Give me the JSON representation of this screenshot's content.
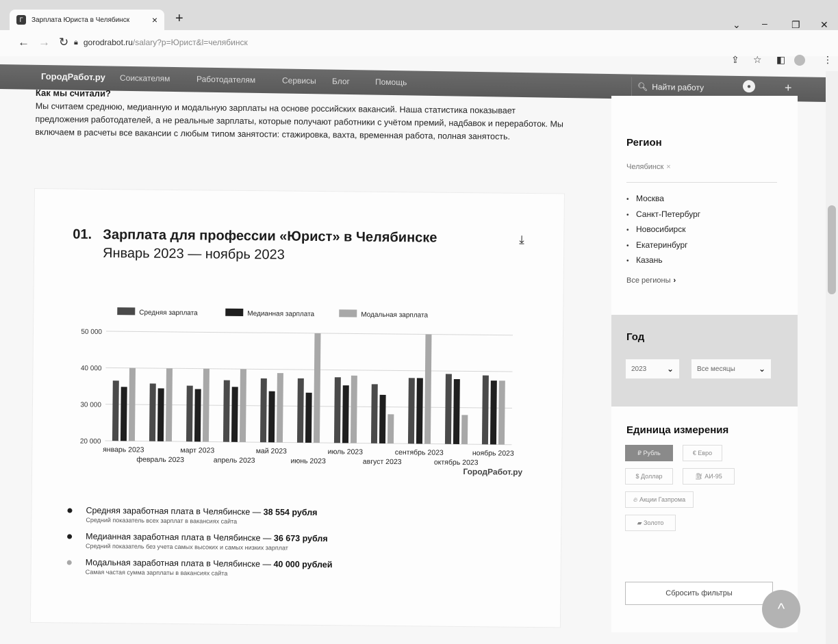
{
  "browser": {
    "tab_title": "Зарплата Юриста в Челябинск",
    "tab_close": "×",
    "new_tab": "+",
    "url": "gorodrabot.ru/salary?p=Юрист&l=челябинск",
    "url_host": "gorodrabot.ru",
    "url_rest": "/salary?p=Юрист&l=челябинск"
  },
  "site": {
    "logo": "ГородРабот.ру",
    "nav": [
      "Соискателям",
      "Работодателям",
      "Сервисы",
      "Блог",
      "Помощь"
    ],
    "find_job": "Найти работу",
    "plus": "+"
  },
  "intro": {
    "heading": "Как мы считали?",
    "text": "Мы считаем среднюю, медианную и модальную зарплаты на основе российских вакансий. Наша статистика показывает предложения работодателей, а не реальные зарплаты, которые получают работники с учётом премий, надбавок и переработок. Мы включаем в расчеты все вакансии с любым типом занятости: стажировка, вахта, временная работа, полная занятость."
  },
  "chart_section": {
    "number": "01.",
    "title": "Зарплата для профессии «Юрист» в Челябинске",
    "subtitle": "Январь 2023 — ноябрь 2023",
    "watermark": "ГородРабот.ру"
  },
  "chart_data": {
    "type": "bar",
    "categories": [
      "январь 2023",
      "февраль 2023",
      "март 2023",
      "апрель 2023",
      "май 2023",
      "июнь 2023",
      "июль 2023",
      "август 2023",
      "сентябрь 2023",
      "октябрь 2023",
      "ноябрь 2023"
    ],
    "series": [
      {
        "name": "Средняя зарплата",
        "color": "#4a4a4a",
        "values": [
          36500,
          35800,
          35300,
          36900,
          37500,
          37600,
          38000,
          36200,
          38000,
          39200,
          38900
        ]
      },
      {
        "name": "Медианная зарплата",
        "color": "#1f1f1f",
        "values": [
          34800,
          34500,
          34400,
          35100,
          34000,
          33700,
          35800,
          33300,
          38000,
          37800,
          37500
        ]
      },
      {
        "name": "Модальная зарплата",
        "color": "#a8a8a8",
        "values": [
          40000,
          40000,
          40000,
          40000,
          39000,
          50000,
          38500,
          28000,
          50000,
          28000,
          37500
        ]
      }
    ],
    "yticks": [
      "20 000",
      "30 000",
      "40 000",
      "50 000"
    ],
    "ylim": [
      20000,
      50000
    ],
    "grid": true,
    "legend": "top"
  },
  "stats": [
    {
      "color": "#1f1f1f",
      "title": "Средняя заработная плата в Челябинске — ",
      "value": "38 554 рубля",
      "desc": "Средний показатель всех зарплат в вакансиях сайта"
    },
    {
      "color": "#1f1f1f",
      "title": "Медианная заработная плата в Челябинске — ",
      "value": "36 673 рубля",
      "desc": "Средний показатель без учета самых высоких и самых низких зарплат"
    },
    {
      "color": "#a8a8a8",
      "title": "Модальная заработная плата в Челябинске — ",
      "value": "40 000 рублей",
      "desc": "Самая частая сумма зарплаты в вакансиях сайта"
    }
  ],
  "sidebar": {
    "region": {
      "heading": "Регион",
      "selected": "Челябинск",
      "selected_remove": "×",
      "list": [
        "Москва",
        "Санкт-Петербург",
        "Новосибирск",
        "Екатеринбург",
        "Казань"
      ],
      "all_regions": "Все регионы",
      "all_regions_arrow": "›"
    },
    "year": {
      "heading": "Год",
      "year_value": "2023",
      "month_value": "Все месяцы"
    },
    "units": {
      "heading": "Единица измерения",
      "buttons": [
        "₽ Рубль",
        "€ Евро",
        "$ Доллар",
        "АИ-95",
        "Акции Газпрома",
        "Золото"
      ],
      "active_index": 0
    },
    "reset": "Сбросить фильтры"
  },
  "fab_label": "^"
}
